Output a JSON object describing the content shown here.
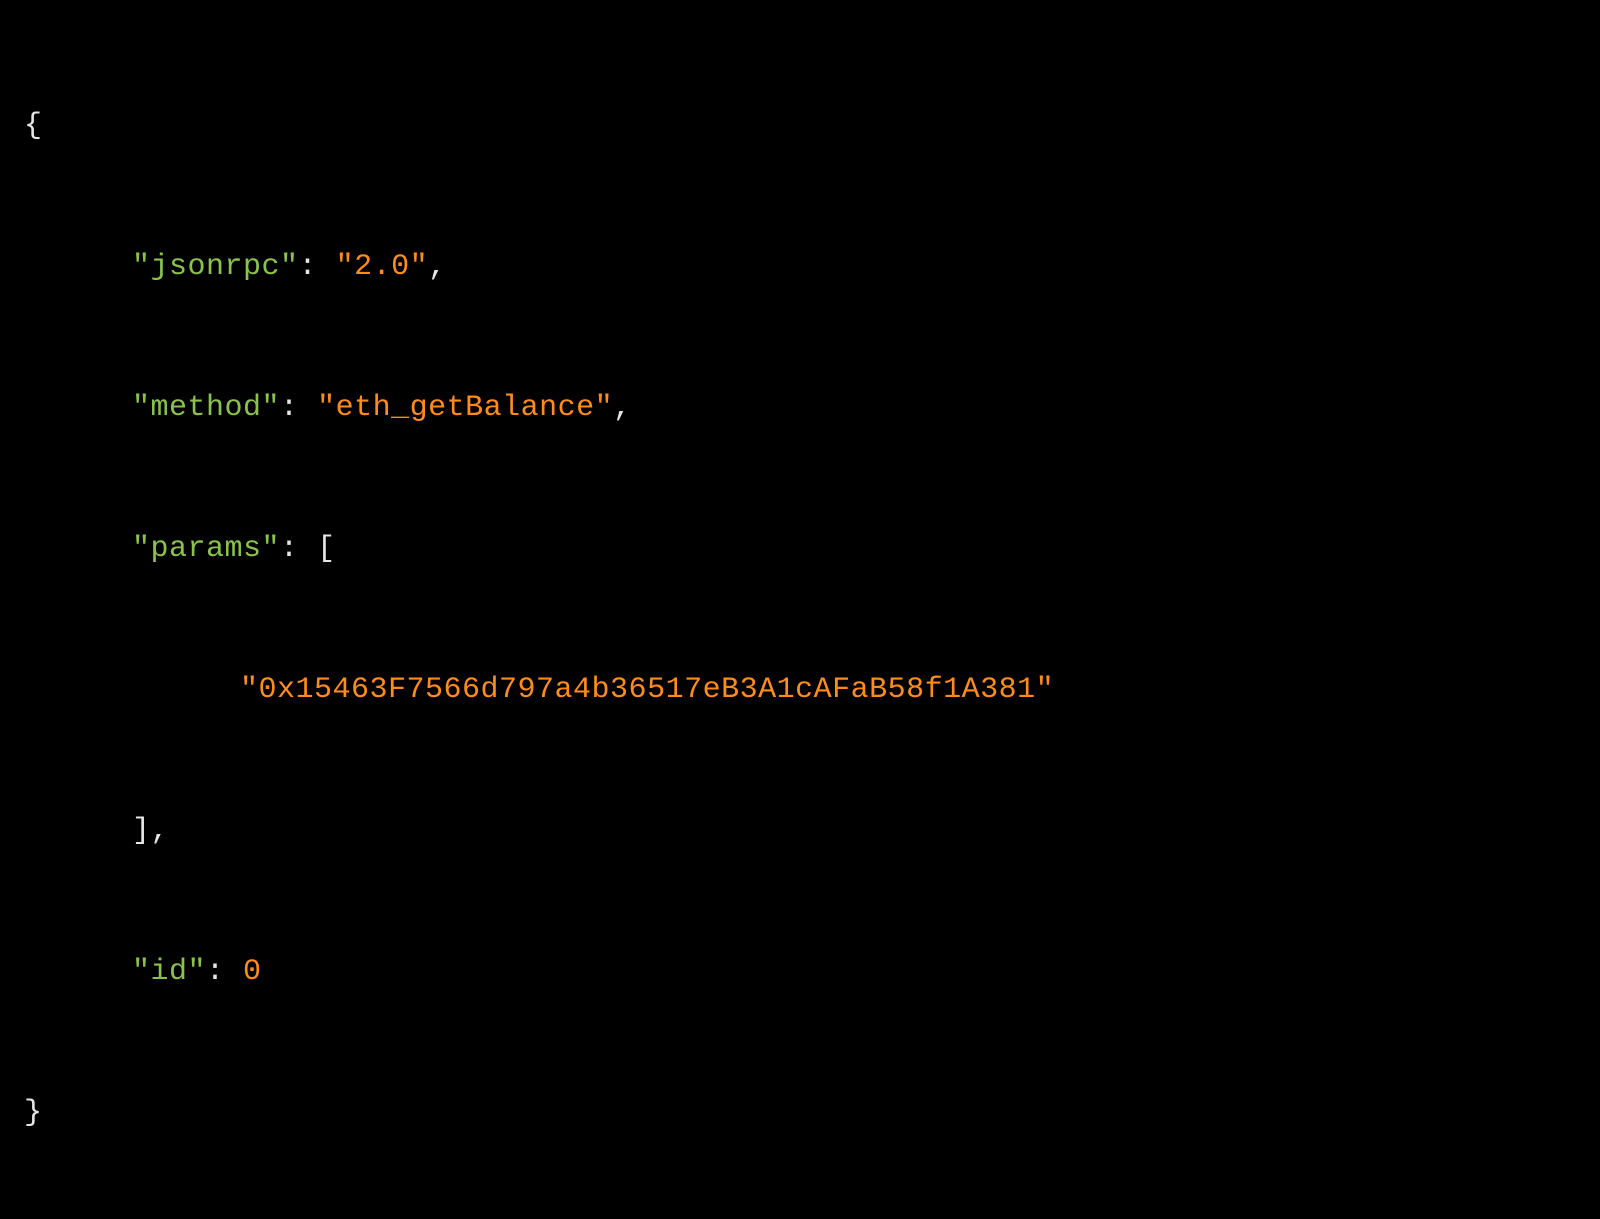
{
  "code": {
    "braceOpen": "{",
    "braceClose": "}",
    "bracketOpen": "[",
    "bracketCloseComma": "],",
    "colon": ":",
    "comma": ",",
    "space": " ",
    "keys": {
      "jsonrpc": "\"jsonrpc\"",
      "method": "\"method\"",
      "params": "\"params\"",
      "id": "\"id\""
    },
    "values": {
      "jsonrpc": "\"2.0\"",
      "method": "\"eth_getBalance\"",
      "param0": "\"0x15463F7566d797a4b36517eB3A1cAFaB58f1A381\"",
      "id": "0"
    }
  }
}
